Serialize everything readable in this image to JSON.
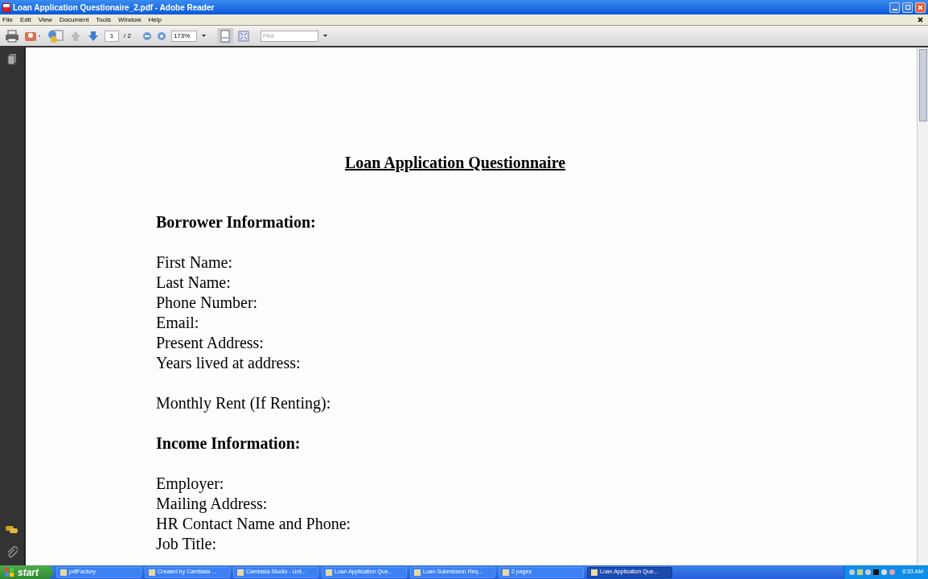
{
  "window": {
    "title": "Loan Application Questionaire_2.pdf - Adobe Reader"
  },
  "menu": [
    "File",
    "Edit",
    "View",
    "Document",
    "Tools",
    "Window",
    "Help"
  ],
  "toolbar": {
    "page": "1",
    "page_total": "/ 2",
    "zoom": "173%",
    "find": {
      "placeholder": "Find"
    }
  },
  "document": {
    "title": "Loan Application Questionnaire",
    "lines": [
      {
        "kind": "heading",
        "text": "Borrower Information:"
      },
      {
        "kind": "gap"
      },
      {
        "kind": "field",
        "text": "First Name:"
      },
      {
        "kind": "field",
        "text": "Last Name:"
      },
      {
        "kind": "field",
        "text": "Phone Number:"
      },
      {
        "kind": "field",
        "text": "Email:"
      },
      {
        "kind": "field",
        "text": "Present Address:"
      },
      {
        "kind": "field",
        "text": "Years lived at address:"
      },
      {
        "kind": "gap"
      },
      {
        "kind": "field",
        "text": "Monthly Rent (If Renting):"
      },
      {
        "kind": "gap"
      },
      {
        "kind": "heading",
        "text": "Income Information:"
      },
      {
        "kind": "gap"
      },
      {
        "kind": "field",
        "text": "Employer:"
      },
      {
        "kind": "field",
        "text": "Mailing Address:"
      },
      {
        "kind": "field",
        "text": "HR Contact Name and Phone:"
      },
      {
        "kind": "field",
        "text": "Job Title:"
      }
    ]
  },
  "taskbar": {
    "start": "start",
    "items": [
      {
        "label": "pdfFactory",
        "selected": false
      },
      {
        "label": "Created by Camtasia ...",
        "selected": false
      },
      {
        "label": "Camtasia Studio - Unt...",
        "selected": false
      },
      {
        "label": "Loan Application Que...",
        "selected": false
      },
      {
        "label": "Loan Submission Req...",
        "selected": false
      },
      {
        "label": "2 pages",
        "selected": false
      },
      {
        "label": "Loan Application Que...",
        "selected": true
      }
    ],
    "clock": "8:53 AM"
  }
}
